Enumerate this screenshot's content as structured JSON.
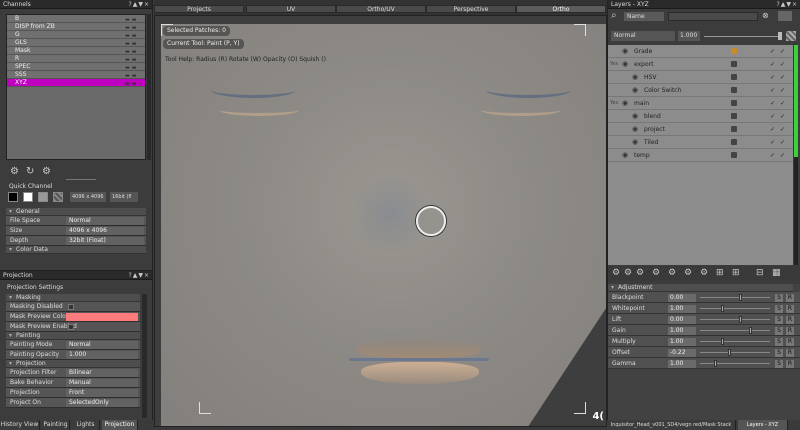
{
  "channels": {
    "title": "Channels",
    "title_buttons": "?▲▼×",
    "items": [
      {
        "label": "B"
      },
      {
        "label": "DISP from ZB"
      },
      {
        "label": "G"
      },
      {
        "label": "GLS"
      },
      {
        "label": "Mask"
      },
      {
        "label": "R"
      },
      {
        "label": "SPEC"
      },
      {
        "label": "SSS"
      },
      {
        "label": "XYZ",
        "selected": true
      }
    ],
    "quick_channel_label": "Quick Channel",
    "size_select": "4096 x 4096",
    "depth_select": "16bit (fl",
    "general_section": "General",
    "properties": [
      {
        "label": "File Space",
        "value": "Normal"
      },
      {
        "label": "Size",
        "value": "4096 x 4096"
      },
      {
        "label": "Depth",
        "value": "32bit (Float)"
      }
    ],
    "color_data_section": "Color Data"
  },
  "projection": {
    "title": "Projection",
    "title_buttons": "?▲▼×",
    "settings_label": "Projection Settings",
    "masking_section": "Masking",
    "masking_rows": [
      {
        "label": "Masking Disabled"
      },
      {
        "label": "Mask Preview Color",
        "color": "#ff7b7b"
      },
      {
        "label": "Mask Preview Enabled"
      }
    ],
    "painting_section": "Painting",
    "painting_rows": [
      {
        "label": "Painting Mode",
        "value": "Normal"
      },
      {
        "label": "Painting Opacity",
        "value": "1.000"
      }
    ],
    "projection_section": "Projection",
    "projection_rows": [
      {
        "label": "Projection Filter",
        "value": "Bilinear"
      },
      {
        "label": "Bake Behavior",
        "value": "Manual"
      },
      {
        "label": "Projection",
        "value": "Front"
      },
      {
        "label": "Project On",
        "value": "SelectedOnly"
      }
    ]
  },
  "view_tabs": [
    {
      "label": "Projects"
    },
    {
      "label": "UV"
    },
    {
      "label": "Ortho/UV"
    },
    {
      "label": "Perspective"
    },
    {
      "label": "Ortho",
      "active": true
    }
  ],
  "viewport": {
    "info_lines": [
      "Selected Patches: 0",
      "Current Tool: Paint (P, Y)"
    ],
    "tool_help": "Tool Help:   Radius (R)   Rotate (W)   Opacity (O)   Squish ()",
    "corner_number": "4("
  },
  "layers": {
    "title": "Layers - XYZ",
    "title_buttons": "?▲▼×",
    "search_mode": "Name",
    "blend_mode": "Normal",
    "opacity": "1.000",
    "items": [
      {
        "name": "Grade",
        "indent": 0,
        "group": false
      },
      {
        "name": "export",
        "indent": 0,
        "group": true
      },
      {
        "name": "HSV",
        "indent": 1,
        "group": false
      },
      {
        "name": "Color Switch",
        "indent": 1,
        "group": false
      },
      {
        "name": "main",
        "indent": 0,
        "group": true
      },
      {
        "name": "blend",
        "indent": 1,
        "group": false
      },
      {
        "name": "project",
        "indent": 1,
        "group": false
      },
      {
        "name": "Tiled",
        "indent": 1,
        "group": false
      },
      {
        "name": "temp",
        "indent": 0,
        "group": false
      }
    ],
    "group_badge": "Yes",
    "adjustment_title": "Adjustment",
    "adjustments": [
      {
        "label": "Blackpoint",
        "value": "0.00",
        "pos": 0.55
      },
      {
        "label": "Whitepoint",
        "value": "1.00",
        "pos": 0.3
      },
      {
        "label": "Lift",
        "value": "0.00",
        "pos": 0.55
      },
      {
        "label": "Gain",
        "value": "1.00",
        "pos": 0.7
      },
      {
        "label": "Multiply",
        "value": "1.00",
        "pos": 0.3
      },
      {
        "label": "Offset",
        "value": "-0.22",
        "pos": 0.4
      },
      {
        "label": "Gamma",
        "value": "1.00",
        "pos": 0.2
      }
    ],
    "s_label": "S",
    "r_label": "R"
  },
  "bottom_tabs_left": [
    {
      "label": "History View"
    },
    {
      "label": "Painting"
    },
    {
      "label": "Lights"
    },
    {
      "label": "Projection",
      "active": true
    }
  ],
  "bottom_tabs_right": [
    {
      "label": "Inquisitor_Head_v001_SD4/vegn red/Mask Stack"
    },
    {
      "label": "Layers - XYZ",
      "active": true
    }
  ],
  "colors": {
    "selection": "#c000c0",
    "mask_preview": "#ff7b7b",
    "level_green": "#3ad13a"
  }
}
